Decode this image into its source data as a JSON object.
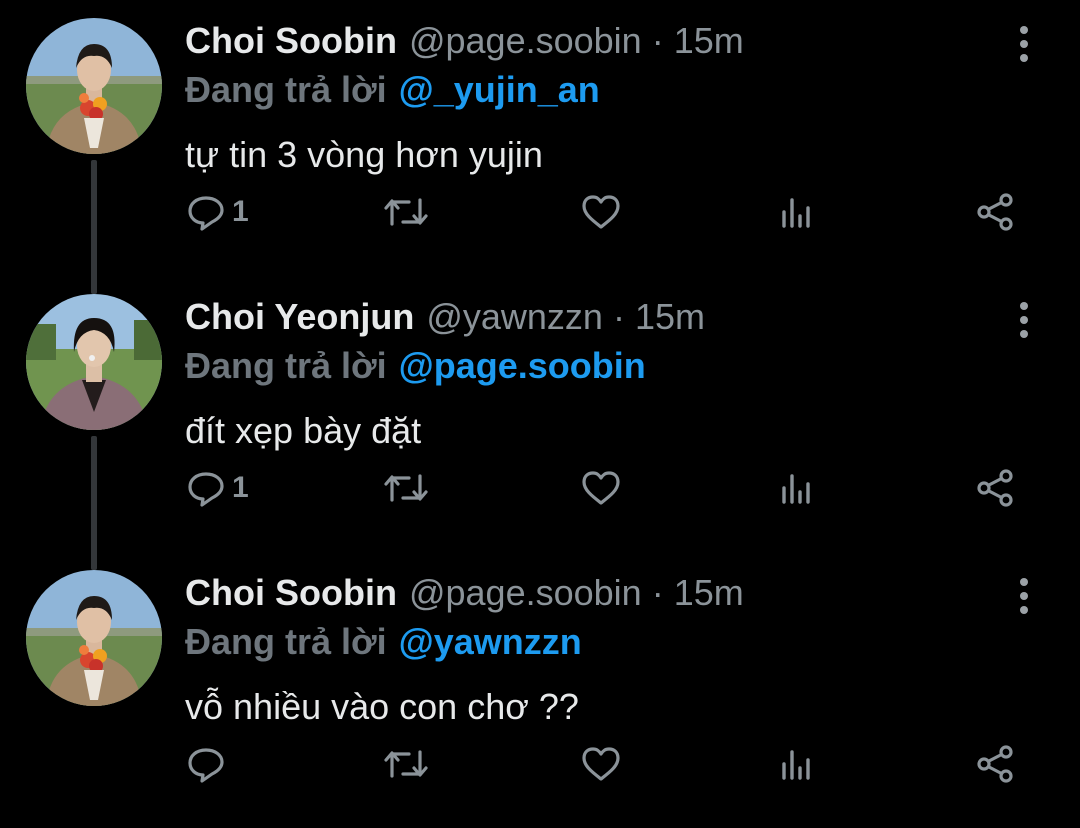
{
  "colors": {
    "background": "#000000",
    "name": "#e7e9ea",
    "secondary": "#8b9399",
    "mention": "#1d9bf0",
    "thread_line": "#333639"
  },
  "tweets": [
    {
      "name": "Choi Soobin",
      "handle": "@page.soobin",
      "separator": "·",
      "time": "15m",
      "reply_prefix": "Đang trả lời",
      "reply_to": "@_yujin_an",
      "text": "tự tin 3 vòng hơn yujin",
      "reply_count": "1",
      "avatar_icon": "profile-photo"
    },
    {
      "name": "Choi Yeonjun",
      "handle": "@yawnzzn",
      "separator": "·",
      "time": "15m",
      "reply_prefix": "Đang trả lời",
      "reply_to": "@page.soobin",
      "text": "đít xẹp bày đặt",
      "reply_count": "1",
      "avatar_icon": "profile-photo"
    },
    {
      "name": "Choi Soobin",
      "handle": "@page.soobin",
      "separator": "·",
      "time": "15m",
      "reply_prefix": "Đang trả lời",
      "reply_to": "@yawnzzn",
      "text": "vỗ nhiều vào con chơ ??",
      "reply_count": "",
      "avatar_icon": "profile-photo"
    }
  ],
  "action_icons": [
    "reply-icon",
    "retweet-icon",
    "like-icon",
    "analytics-icon",
    "share-icon"
  ]
}
